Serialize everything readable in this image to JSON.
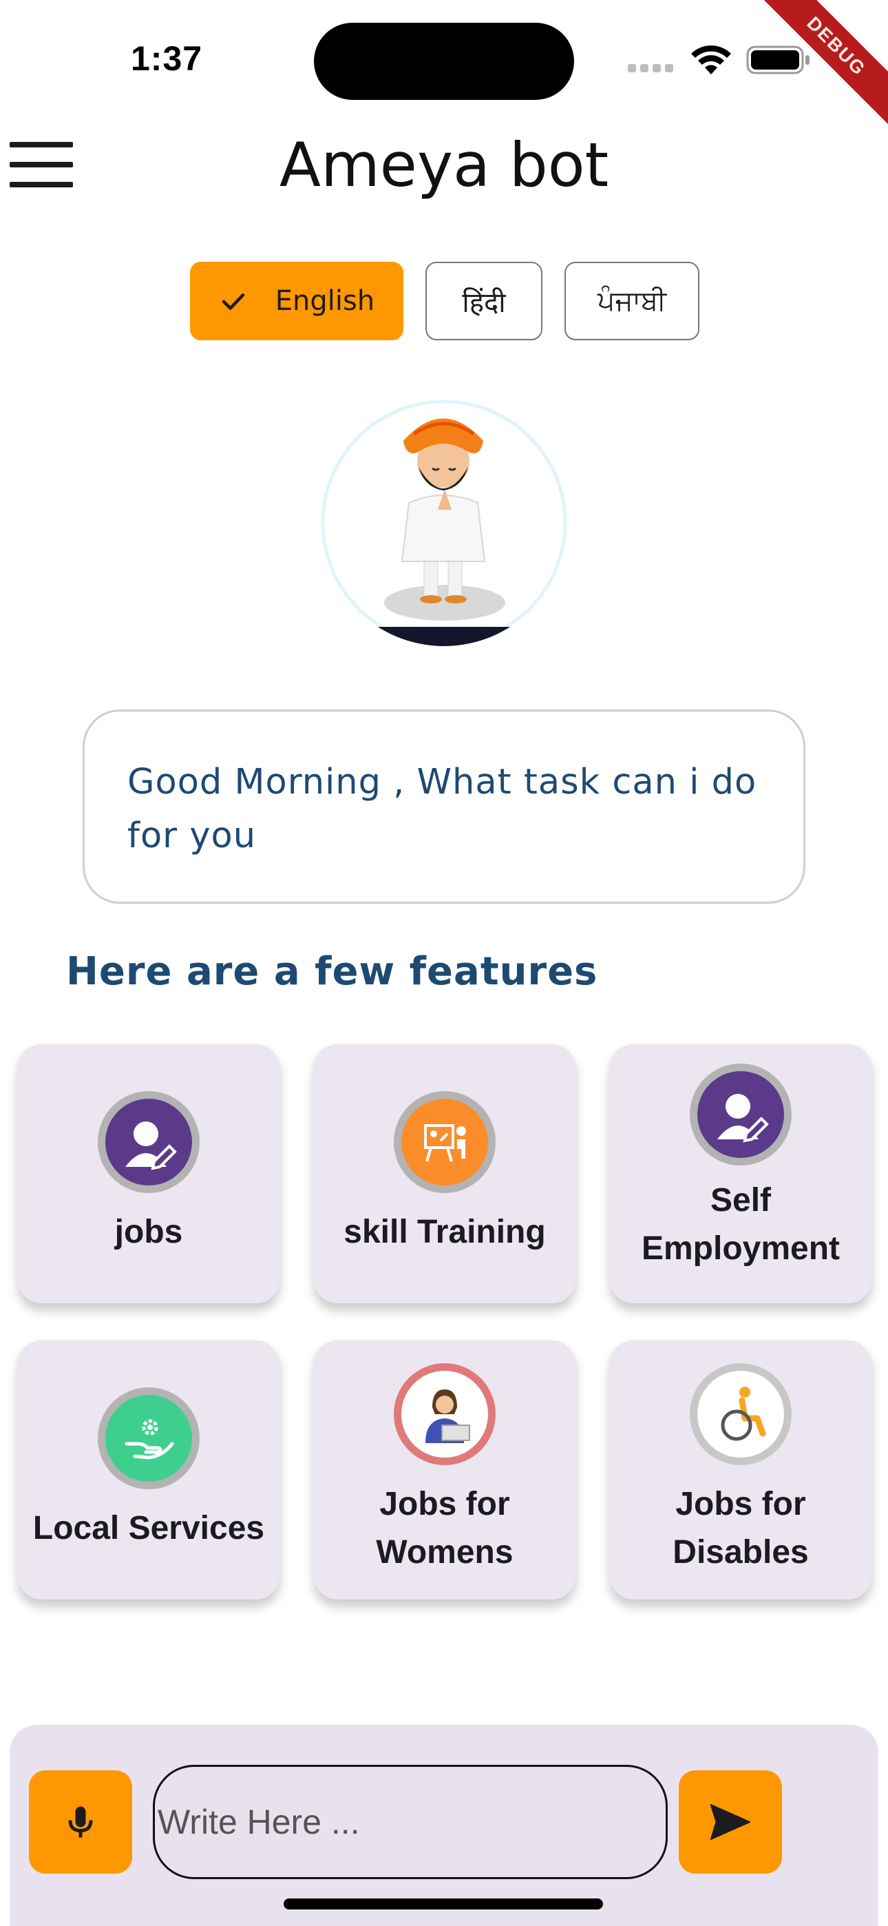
{
  "status_bar": {
    "time": "1:37",
    "debug_label": "DEBUG"
  },
  "app_bar": {
    "title": "Ameya bot",
    "menu_icon": "hamburger-menu-icon"
  },
  "languages": [
    {
      "label": "English",
      "selected": true
    },
    {
      "label": "हिंदी",
      "selected": false
    },
    {
      "label": "ਪੰਜਾਬੀ",
      "selected": false
    }
  ],
  "greeting": {
    "text": "Good Morning , What task can i do for you"
  },
  "features": {
    "heading": "Here are a few features",
    "items": [
      {
        "label": "jobs",
        "icon": "user-edit-icon"
      },
      {
        "label": "skill Training",
        "icon": "training-board-icon"
      },
      {
        "label": "Self Employment",
        "icon": "user-edit-icon"
      },
      {
        "label": "Local Services",
        "icon": "service-hand-gear-icon"
      },
      {
        "label": "Jobs for Womens",
        "icon": "woman-laptop-icon"
      },
      {
        "label": "Jobs for Disables",
        "icon": "wheelchair-icon"
      }
    ]
  },
  "input_bar": {
    "placeholder": "Write Here ...",
    "mic_icon": "microphone-icon",
    "send_icon": "send-icon"
  },
  "colors": {
    "accent": "#ff9800",
    "heading": "#1e4a72",
    "card": "#ece6f0",
    "bar": "#e8e2ee"
  }
}
